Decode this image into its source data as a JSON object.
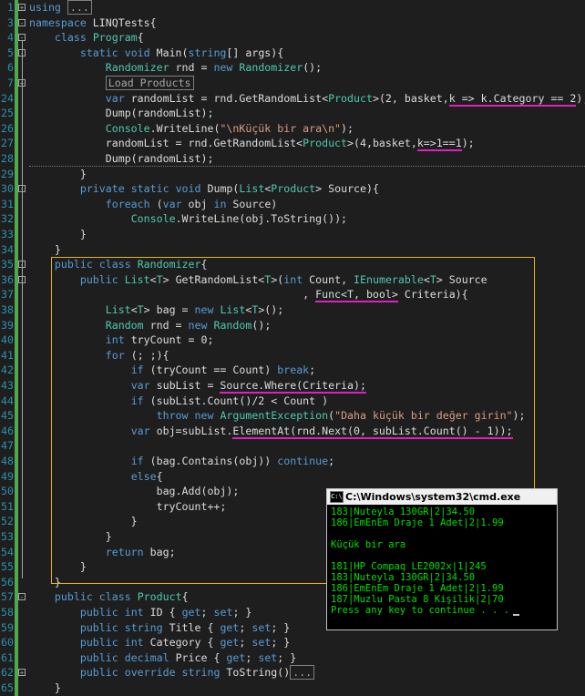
{
  "editor": {
    "lines": [
      {
        "n": "1",
        "segs": [
          {
            "c": "k",
            "t": "using"
          },
          {
            "c": "p",
            "t": " "
          },
          {
            "c": "collapsed",
            "t": "..."
          }
        ]
      },
      {
        "n": "3",
        "segs": [
          {
            "c": "k",
            "t": "namespace"
          },
          {
            "c": "p",
            "t": " LINQTests{"
          }
        ]
      },
      {
        "n": "4",
        "segs": [
          {
            "c": "p",
            "t": "    "
          },
          {
            "c": "k",
            "t": "class"
          },
          {
            "c": "p",
            "t": " "
          },
          {
            "c": "t",
            "t": "Program"
          },
          {
            "c": "p",
            "t": "{"
          }
        ]
      },
      {
        "n": "5",
        "segs": [
          {
            "c": "p",
            "t": "        "
          },
          {
            "c": "k",
            "t": "static"
          },
          {
            "c": "p",
            "t": " "
          },
          {
            "c": "k",
            "t": "void"
          },
          {
            "c": "p",
            "t": " Main("
          },
          {
            "c": "k",
            "t": "string"
          },
          {
            "c": "p",
            "t": "[] args){"
          }
        ]
      },
      {
        "n": "6",
        "segs": [
          {
            "c": "p",
            "t": "            "
          },
          {
            "c": "t",
            "t": "Randomizer"
          },
          {
            "c": "p",
            "t": " rnd = "
          },
          {
            "c": "k",
            "t": "new"
          },
          {
            "c": "p",
            "t": " "
          },
          {
            "c": "t",
            "t": "Randomizer"
          },
          {
            "c": "p",
            "t": "();"
          }
        ]
      },
      {
        "n": "7",
        "segs": [
          {
            "c": "p",
            "t": "            "
          },
          {
            "c": "collapsed",
            "t": "Load Products"
          }
        ]
      },
      {
        "n": "24",
        "segs": [
          {
            "c": "p",
            "t": "            "
          },
          {
            "c": "k",
            "t": "var"
          },
          {
            "c": "p",
            "t": " randomList = rnd.GetRandomList<"
          },
          {
            "c": "t",
            "t": "Product"
          },
          {
            "c": "p",
            "t": ">(2, basket,"
          },
          {
            "c": "ul",
            "t": "k => k.Category == 2"
          },
          {
            "c": "p",
            "t": ");"
          }
        ]
      },
      {
        "n": "25",
        "segs": [
          {
            "c": "p",
            "t": "            Dump(randomList);"
          }
        ]
      },
      {
        "n": "26",
        "segs": [
          {
            "c": "p",
            "t": "            "
          },
          {
            "c": "t",
            "t": "Console"
          },
          {
            "c": "p",
            "t": ".WriteLine("
          },
          {
            "c": "s",
            "t": "\"\\nKüçük bir ara\\n\""
          },
          {
            "c": "p",
            "t": ");"
          }
        ]
      },
      {
        "n": "27",
        "segs": [
          {
            "c": "p",
            "t": "            randomList = rnd.GetRandomList<"
          },
          {
            "c": "t",
            "t": "Product"
          },
          {
            "c": "p",
            "t": ">(4,basket,"
          },
          {
            "c": "ul",
            "t": "k=>1==1"
          },
          {
            "c": "p",
            "t": ");"
          }
        ]
      },
      {
        "n": "28",
        "segs": [
          {
            "c": "p",
            "t": "            Dump(randomList);"
          }
        ]
      },
      {
        "n": "29",
        "segs": [
          {
            "c": "p",
            "t": "        }"
          }
        ]
      },
      {
        "n": "30",
        "segs": [
          {
            "c": "p",
            "t": "        "
          },
          {
            "c": "k",
            "t": "private"
          },
          {
            "c": "p",
            "t": " "
          },
          {
            "c": "k",
            "t": "static"
          },
          {
            "c": "p",
            "t": " "
          },
          {
            "c": "k",
            "t": "void"
          },
          {
            "c": "p",
            "t": " Dump("
          },
          {
            "c": "t",
            "t": "List"
          },
          {
            "c": "p",
            "t": "<"
          },
          {
            "c": "t",
            "t": "Product"
          },
          {
            "c": "p",
            "t": "> Source){"
          }
        ]
      },
      {
        "n": "31",
        "segs": [
          {
            "c": "p",
            "t": "            "
          },
          {
            "c": "k",
            "t": "foreach"
          },
          {
            "c": "p",
            "t": " ("
          },
          {
            "c": "k",
            "t": "var"
          },
          {
            "c": "p",
            "t": " obj "
          },
          {
            "c": "k",
            "t": "in"
          },
          {
            "c": "p",
            "t": " Source)"
          }
        ]
      },
      {
        "n": "32",
        "segs": [
          {
            "c": "p",
            "t": "                "
          },
          {
            "c": "t",
            "t": "Console"
          },
          {
            "c": "p",
            "t": ".WriteLine(obj.ToString());"
          }
        ]
      },
      {
        "n": "33",
        "segs": [
          {
            "c": "p",
            "t": "        }"
          }
        ]
      },
      {
        "n": "34",
        "segs": [
          {
            "c": "p",
            "t": "    }"
          }
        ]
      },
      {
        "n": "35",
        "segs": [
          {
            "c": "p",
            "t": "    "
          },
          {
            "c": "k",
            "t": "public"
          },
          {
            "c": "p",
            "t": " "
          },
          {
            "c": "k",
            "t": "class"
          },
          {
            "c": "p",
            "t": " "
          },
          {
            "c": "t",
            "t": "Randomizer"
          },
          {
            "c": "p",
            "t": "{"
          }
        ]
      },
      {
        "n": "36",
        "segs": [
          {
            "c": "p",
            "t": "        "
          },
          {
            "c": "k",
            "t": "public"
          },
          {
            "c": "p",
            "t": " "
          },
          {
            "c": "t",
            "t": "List"
          },
          {
            "c": "p",
            "t": "<"
          },
          {
            "c": "t",
            "t": "T"
          },
          {
            "c": "p",
            "t": "> GetRandomList<"
          },
          {
            "c": "t",
            "t": "T"
          },
          {
            "c": "p",
            "t": ">("
          },
          {
            "c": "k",
            "t": "int"
          },
          {
            "c": "p",
            "t": " Count, "
          },
          {
            "c": "t",
            "t": "IEnumerable"
          },
          {
            "c": "p",
            "t": "<"
          },
          {
            "c": "t",
            "t": "T"
          },
          {
            "c": "p",
            "t": "> Source"
          }
        ]
      },
      {
        "n": "37",
        "segs": [
          {
            "c": "p",
            "t": "                                           , "
          },
          {
            "c": "ul",
            "t": "Func<T, bool>"
          },
          {
            "c": "p",
            "t": " Criteria){"
          }
        ]
      },
      {
        "n": "38",
        "segs": [
          {
            "c": "p",
            "t": "            "
          },
          {
            "c": "t",
            "t": "List"
          },
          {
            "c": "p",
            "t": "<"
          },
          {
            "c": "t",
            "t": "T"
          },
          {
            "c": "p",
            "t": "> bag = "
          },
          {
            "c": "k",
            "t": "new"
          },
          {
            "c": "p",
            "t": " "
          },
          {
            "c": "t",
            "t": "List"
          },
          {
            "c": "p",
            "t": "<"
          },
          {
            "c": "t",
            "t": "T"
          },
          {
            "c": "p",
            "t": ">();"
          }
        ]
      },
      {
        "n": "39",
        "segs": [
          {
            "c": "p",
            "t": "            "
          },
          {
            "c": "t",
            "t": "Random"
          },
          {
            "c": "p",
            "t": " rnd = "
          },
          {
            "c": "k",
            "t": "new"
          },
          {
            "c": "p",
            "t": " "
          },
          {
            "c": "t",
            "t": "Random"
          },
          {
            "c": "p",
            "t": "();"
          }
        ]
      },
      {
        "n": "40",
        "segs": [
          {
            "c": "p",
            "t": "            "
          },
          {
            "c": "k",
            "t": "int"
          },
          {
            "c": "p",
            "t": " tryCount = 0;"
          }
        ]
      },
      {
        "n": "41",
        "segs": [
          {
            "c": "p",
            "t": "            "
          },
          {
            "c": "k",
            "t": "for"
          },
          {
            "c": "p",
            "t": " (; ;){"
          }
        ]
      },
      {
        "n": "42",
        "segs": [
          {
            "c": "p",
            "t": "                "
          },
          {
            "c": "k",
            "t": "if"
          },
          {
            "c": "p",
            "t": " (tryCount == Count) "
          },
          {
            "c": "k",
            "t": "break"
          },
          {
            "c": "p",
            "t": ";"
          }
        ]
      },
      {
        "n": "43",
        "segs": [
          {
            "c": "p",
            "t": "                "
          },
          {
            "c": "k",
            "t": "var"
          },
          {
            "c": "p",
            "t": " subList = "
          },
          {
            "c": "ul",
            "t": "Source.Where(Criteria);"
          }
        ]
      },
      {
        "n": "44",
        "segs": [
          {
            "c": "p",
            "t": "                "
          },
          {
            "c": "k",
            "t": "if"
          },
          {
            "c": "p",
            "t": " (subList.Count()/2 < Count )"
          }
        ]
      },
      {
        "n": "45",
        "segs": [
          {
            "c": "p",
            "t": "                    "
          },
          {
            "c": "k",
            "t": "throw"
          },
          {
            "c": "p",
            "t": " "
          },
          {
            "c": "k",
            "t": "new"
          },
          {
            "c": "p",
            "t": " "
          },
          {
            "c": "t",
            "t": "ArgumentException"
          },
          {
            "c": "p",
            "t": "("
          },
          {
            "c": "s",
            "t": "\"Daha küçük bir değer girin\""
          },
          {
            "c": "p",
            "t": ");"
          }
        ]
      },
      {
        "n": "46",
        "segs": [
          {
            "c": "p",
            "t": "                "
          },
          {
            "c": "k",
            "t": "var"
          },
          {
            "c": "p",
            "t": " obj=subList."
          },
          {
            "c": "ul",
            "t": "ElementAt(rnd.Next(0, subList.Count() - 1));"
          }
        ]
      },
      {
        "n": "47",
        "segs": []
      },
      {
        "n": "48",
        "segs": [
          {
            "c": "p",
            "t": "                "
          },
          {
            "c": "k",
            "t": "if"
          },
          {
            "c": "p",
            "t": " (bag.Contains(obj)) "
          },
          {
            "c": "k",
            "t": "continue"
          },
          {
            "c": "p",
            "t": ";"
          }
        ]
      },
      {
        "n": "49",
        "segs": [
          {
            "c": "p",
            "t": "                "
          },
          {
            "c": "k",
            "t": "else"
          },
          {
            "c": "p",
            "t": "{"
          }
        ]
      },
      {
        "n": "50",
        "segs": [
          {
            "c": "p",
            "t": "                    bag.Add(obj);"
          }
        ]
      },
      {
        "n": "51",
        "segs": [
          {
            "c": "p",
            "t": "                    tryCount++;"
          }
        ]
      },
      {
        "n": "52",
        "segs": [
          {
            "c": "p",
            "t": "                }"
          }
        ]
      },
      {
        "n": "53",
        "segs": [
          {
            "c": "p",
            "t": "            }"
          }
        ]
      },
      {
        "n": "54",
        "segs": [
          {
            "c": "p",
            "t": "            "
          },
          {
            "c": "k",
            "t": "return"
          },
          {
            "c": "p",
            "t": " bag;"
          }
        ]
      },
      {
        "n": "55",
        "segs": [
          {
            "c": "p",
            "t": "        }"
          }
        ]
      },
      {
        "n": "56",
        "segs": [
          {
            "c": "p",
            "t": "    }"
          }
        ]
      },
      {
        "n": "57",
        "segs": [
          {
            "c": "p",
            "t": "    "
          },
          {
            "c": "k",
            "t": "public"
          },
          {
            "c": "p",
            "t": " "
          },
          {
            "c": "k",
            "t": "class"
          },
          {
            "c": "p",
            "t": " "
          },
          {
            "c": "t",
            "t": "Product"
          },
          {
            "c": "p",
            "t": "{"
          }
        ]
      },
      {
        "n": "58",
        "segs": [
          {
            "c": "p",
            "t": "        "
          },
          {
            "c": "k",
            "t": "public"
          },
          {
            "c": "p",
            "t": " "
          },
          {
            "c": "k",
            "t": "int"
          },
          {
            "c": "p",
            "t": " ID { "
          },
          {
            "c": "k",
            "t": "get"
          },
          {
            "c": "p",
            "t": "; "
          },
          {
            "c": "k",
            "t": "set"
          },
          {
            "c": "p",
            "t": "; }"
          }
        ]
      },
      {
        "n": "59",
        "segs": [
          {
            "c": "p",
            "t": "        "
          },
          {
            "c": "k",
            "t": "public"
          },
          {
            "c": "p",
            "t": " "
          },
          {
            "c": "k",
            "t": "string"
          },
          {
            "c": "p",
            "t": " Title { "
          },
          {
            "c": "k",
            "t": "get"
          },
          {
            "c": "p",
            "t": "; "
          },
          {
            "c": "k",
            "t": "set"
          },
          {
            "c": "p",
            "t": "; }"
          }
        ]
      },
      {
        "n": "60",
        "segs": [
          {
            "c": "p",
            "t": "        "
          },
          {
            "c": "k",
            "t": "public"
          },
          {
            "c": "p",
            "t": " "
          },
          {
            "c": "k",
            "t": "int"
          },
          {
            "c": "p",
            "t": " Category { "
          },
          {
            "c": "k",
            "t": "get"
          },
          {
            "c": "p",
            "t": "; "
          },
          {
            "c": "k",
            "t": "set"
          },
          {
            "c": "p",
            "t": "; }"
          }
        ]
      },
      {
        "n": "61",
        "segs": [
          {
            "c": "p",
            "t": "        "
          },
          {
            "c": "k",
            "t": "public"
          },
          {
            "c": "p",
            "t": " "
          },
          {
            "c": "k",
            "t": "decimal"
          },
          {
            "c": "p",
            "t": " Price { "
          },
          {
            "c": "k",
            "t": "get"
          },
          {
            "c": "p",
            "t": "; "
          },
          {
            "c": "k",
            "t": "set"
          },
          {
            "c": "p",
            "t": "; }"
          }
        ]
      },
      {
        "n": "62",
        "segs": [
          {
            "c": "p",
            "t": "        "
          },
          {
            "c": "k",
            "t": "public"
          },
          {
            "c": "p",
            "t": " "
          },
          {
            "c": "k",
            "t": "override"
          },
          {
            "c": "p",
            "t": " "
          },
          {
            "c": "k",
            "t": "string"
          },
          {
            "c": "p",
            "t": " ToString()"
          },
          {
            "c": "collapsed",
            "t": "..."
          }
        ]
      },
      {
        "n": "65",
        "segs": [
          {
            "c": "p",
            "t": "    }"
          }
        ]
      }
    ]
  },
  "cmd": {
    "title": "C:\\Windows\\system32\\cmd.exe",
    "icon_label": "C:\\",
    "lines": [
      "183|Nuteyla 130GR|2|34.50",
      "186|EmEnEm Draje 1 Adet|2|1.99",
      "",
      "Küçük bir ara",
      "",
      "181|HP Compaq LE2002x|1|245",
      "183|Nuteyla 130GR|2|34.50",
      "186|EmEnEm Draje 1 Adet|2|1.99",
      "187|Muzlu Pasta 8 Kişilik|2|70",
      "Press any key to continue . . ."
    ]
  },
  "colors": {
    "background": "#1e1e1e",
    "keyword": "#569cd6",
    "type": "#4ec9b0",
    "string": "#d69d85",
    "plain": "#dcdcdc",
    "line_number": "#2b91af",
    "underline": "#e020c0",
    "highlight_box": "#e8b400",
    "console_text": "#00e000"
  }
}
